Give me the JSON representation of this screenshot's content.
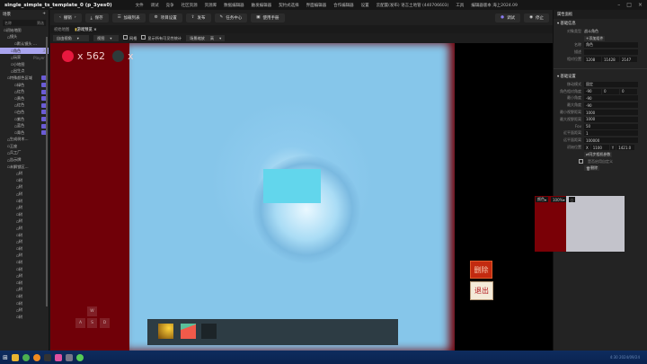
{
  "title": "single_simple_ts_template_0 (p_3yes0)",
  "menu": [
    "文件",
    "调试",
    "竞争",
    "社区资源",
    "资源库",
    "数据编辑器",
    "触发编辑器",
    "契约式选择",
    "界面编辑器",
    "合作编辑器",
    "设置",
    "云配置(发布) 语言土地管 (440706603)",
    "工具",
    "编辑器版本 海上2024.09"
  ],
  "left": {
    "title": "场景",
    "search_placeholder": "名称",
    "search_btn": "筛选",
    "tree": [
      {
        "label": "初始地图",
        "indent": 1
      },
      {
        "label": "镜头",
        "indent": 2
      },
      {
        "label": "默认镜头 ...",
        "indent": 4
      },
      {
        "label": "角色",
        "indent": 3,
        "selected": true,
        "suffix": "3"
      },
      {
        "label": "玩家",
        "indent": 3,
        "suffix": "Player"
      },
      {
        "label": "小地图",
        "indent": 3
      },
      {
        "label": "出生点",
        "indent": 3
      },
      {
        "label": "特殊颜色区域",
        "indent": 2,
        "badge": true
      },
      {
        "label": "绿色",
        "indent": 4,
        "badge": true
      },
      {
        "label": "红色",
        "indent": 4,
        "badge": true
      },
      {
        "label": "黄色",
        "indent": 4,
        "badge": true
      },
      {
        "label": "红色",
        "indent": 4,
        "badge": true
      },
      {
        "label": "白色",
        "indent": 4,
        "badge": true
      },
      {
        "label": "紫色",
        "indent": 4,
        "badge": true
      },
      {
        "label": "蓝色",
        "indent": 4,
        "badge": true
      },
      {
        "label": "青色",
        "indent": 4,
        "badge": true
      },
      {
        "label": "生成树木...",
        "indent": 2
      },
      {
        "label": "王座",
        "indent": 2
      },
      {
        "label": "兵工厂",
        "indent": 2
      },
      {
        "label": "告示牌",
        "indent": 2
      },
      {
        "label": "未解锁区...",
        "indent": 2
      }
    ],
    "leaf_label": "树",
    "leaf_count": 22
  },
  "toolbar": {
    "back": "撤销",
    "save": "保存",
    "add_list": "加载列表",
    "project_settings": "项目设置",
    "publish": "发布",
    "task_center": "任务中心",
    "user_manual": "使用手册",
    "debug": "调试",
    "stop": "停止"
  },
  "tabs": [
    "初始地图",
    "游戏预览"
  ],
  "options": {
    "view_mode": "自由视角",
    "camera": "视图",
    "grid": "网格",
    "show_all": "显示所有可见性统计",
    "scene_size_label": "场景缩放",
    "scene_size": "高"
  },
  "game": {
    "counter": "x 562",
    "counter2": "x",
    "keys": [
      "W",
      "A",
      "S",
      "D"
    ],
    "delete": "删除",
    "exit": "退出",
    "red": "#700008",
    "blue": "#86c6ea"
  },
  "right": {
    "title": "属性面板",
    "section1": "基础信息",
    "object_type_label": "对象类型",
    "object_type": "战斗角色",
    "add_component": "添加组件",
    "name_label": "名称",
    "name": "角色",
    "note_label": "描述",
    "pos_label": "相对位置",
    "pos": [
      "1208",
      "11428",
      "2147"
    ],
    "section2": "基础设置",
    "rows": [
      {
        "l": "移动模式",
        "v": "固定"
      },
      {
        "l": "角色相对角度",
        "v": "-90"
      },
      {
        "l": "最小角度",
        "v": "-90"
      },
      {
        "l": "最大角度",
        "v": "-90"
      },
      {
        "l": "最小视野距离",
        "v": "1000"
      },
      {
        "l": "最大视野距离",
        "v": "1000"
      },
      {
        "l": "Fov",
        "v": "50"
      },
      {
        "l": "近平面距离",
        "v": "1"
      },
      {
        "l": "远平面距离",
        "v": "100000"
      }
    ],
    "angle_extra": [
      "0",
      "0"
    ],
    "cam_pos_label": "初始位置",
    "cam_pos": [
      "X",
      "1100",
      "Y",
      "1421.0"
    ],
    "sync": "同步相机参数",
    "checkbox": "是否启用自定义",
    "delete": "删除"
  },
  "preview": {
    "mode": "颜色",
    "zoom": "100%"
  },
  "taskbar_time": "4:30 2024/09/24"
}
